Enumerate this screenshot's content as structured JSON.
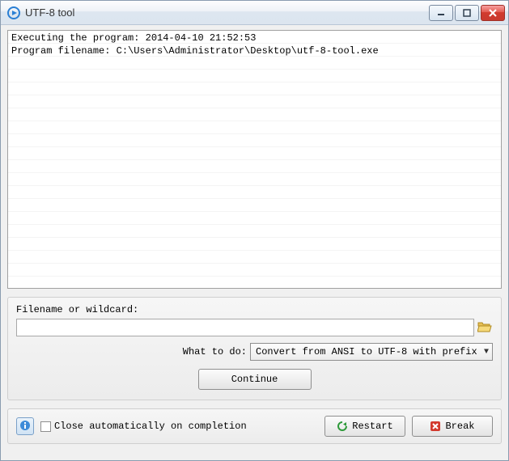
{
  "window": {
    "title": "UTF-8 tool"
  },
  "log": {
    "lines": [
      "Executing the program:  2014-04-10 21:52:53",
      "Program filename: C:\\Users\\Administrator\\Desktop\\utf-8-tool.exe"
    ]
  },
  "form": {
    "filename_label": "Filename or wildcard:",
    "filename_value": "",
    "what_label": "What to do:",
    "what_selected": "Convert from ANSI to UTF-8 with prefix",
    "continue_label": "Continue"
  },
  "footer": {
    "close_auto_label": "Close automatically on completion",
    "close_auto_checked": false,
    "restart_label": "Restart",
    "break_label": "Break"
  },
  "icons": {
    "app": "play-circle-icon",
    "minimize": "minimize-icon",
    "maximize": "maximize-icon",
    "close": "close-icon",
    "folder": "folder-open-icon",
    "dropdown": "chevron-down-icon",
    "info": "info-icon",
    "restart": "refresh-icon",
    "break": "stop-icon"
  }
}
